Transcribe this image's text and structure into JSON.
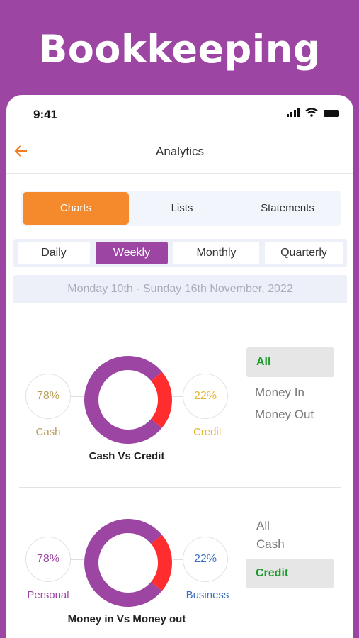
{
  "headline": "Bookkeeping",
  "status": {
    "time": "9:41"
  },
  "nav": {
    "title": "Analytics"
  },
  "view_tabs": [
    "Charts",
    "Lists",
    "Statements"
  ],
  "period_tabs": [
    "Daily",
    "Weekly",
    "Monthly",
    "Quarterly"
  ],
  "date_range": "Monday 10th  -  Sunday 16th November, 2022",
  "chart1": {
    "left_value": "78%",
    "left_label": "Cash",
    "right_value": "22%",
    "right_label": "Credit",
    "caption": "Cash Vs Credit",
    "filters": [
      "All",
      "Money In",
      "Money Out"
    ]
  },
  "chart2": {
    "left_value": "78%",
    "left_label": "Personal",
    "right_value": "22%",
    "right_label": "Business",
    "caption": "Money in Vs Money out",
    "filters": [
      "All",
      "Cash",
      "Credit"
    ]
  },
  "chart_data": [
    {
      "type": "pie",
      "title": "Cash Vs Credit",
      "categories": [
        "Cash",
        "Credit"
      ],
      "values": [
        78,
        22
      ],
      "colors": [
        "#9c45a3",
        "#ff2d2d"
      ]
    },
    {
      "type": "pie",
      "title": "Money in Vs Money out",
      "categories": [
        "Personal",
        "Business"
      ],
      "values": [
        78,
        22
      ],
      "colors": [
        "#9c45a3",
        "#ff2d2d"
      ]
    }
  ],
  "colors": {
    "purple": "#9c45a3",
    "orange": "#f58a2d",
    "red": "#ff2d2d",
    "green": "#1c9b2a"
  }
}
